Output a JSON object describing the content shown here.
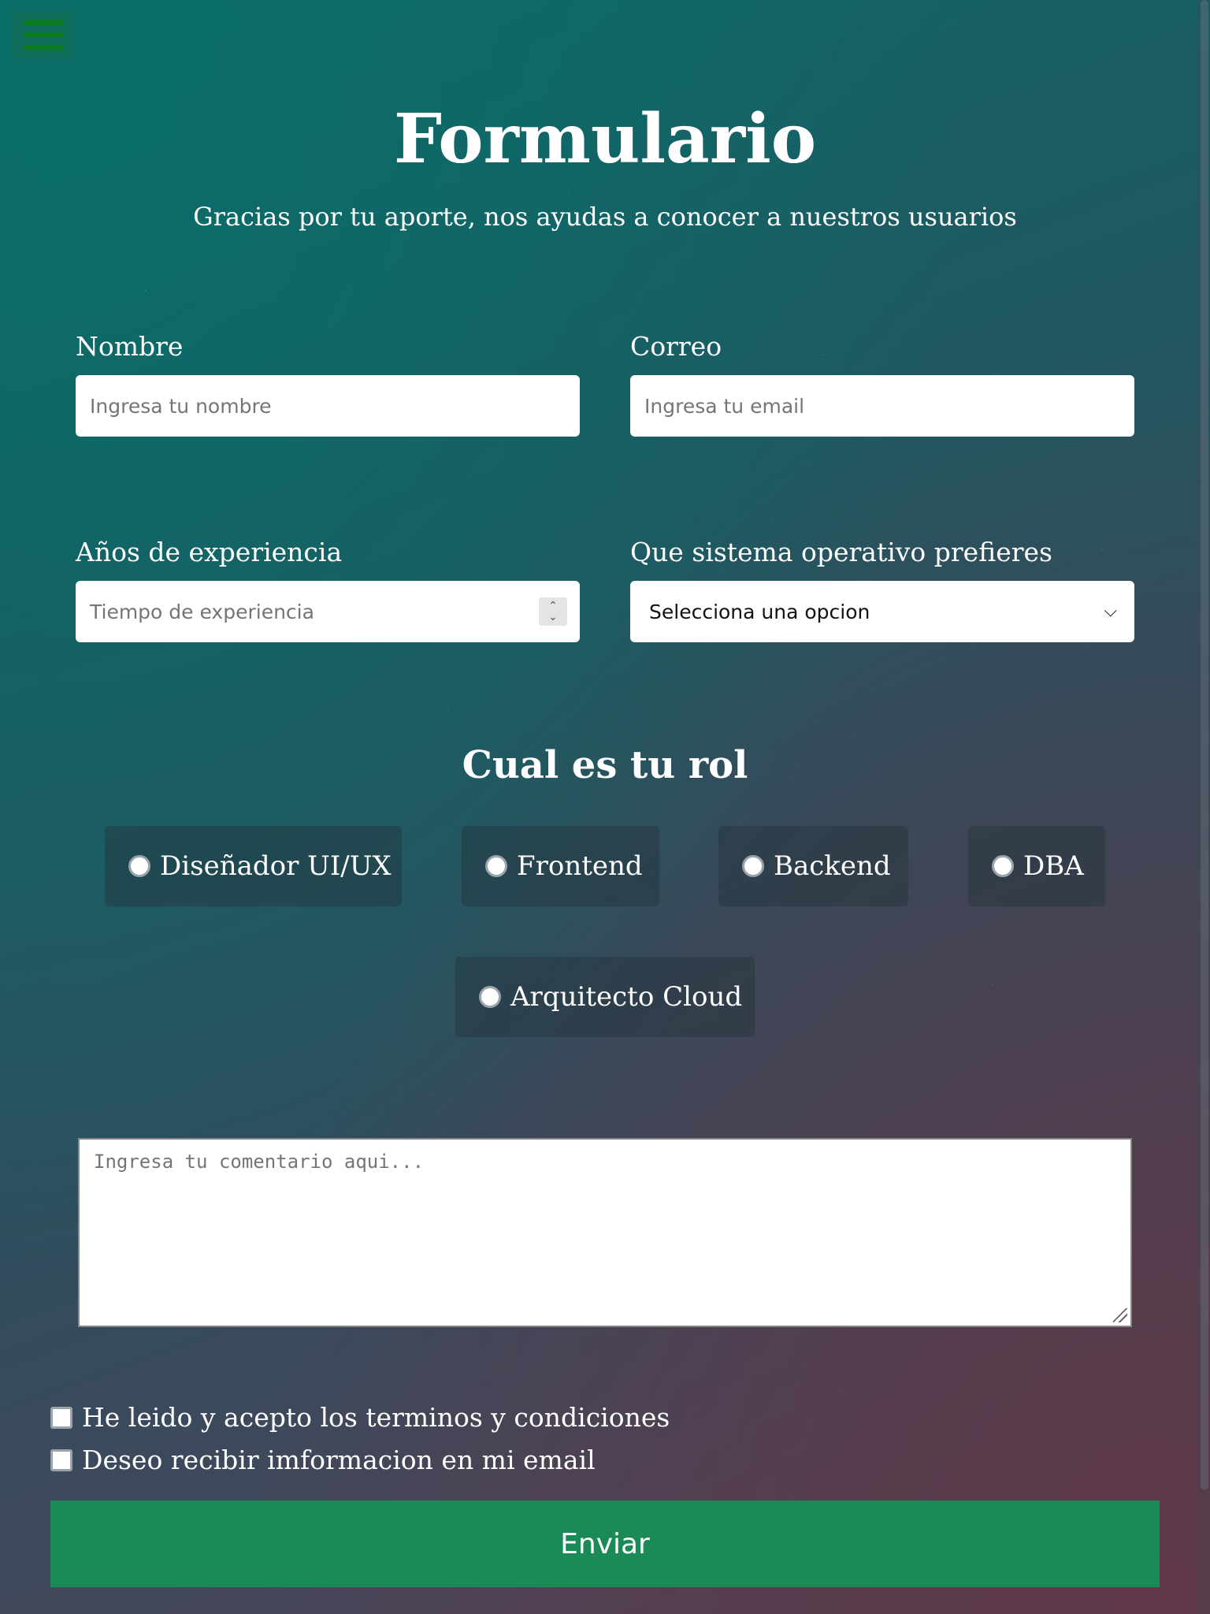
{
  "header": {
    "title": "Formulario",
    "subtitle": "Gracias por tu aporte, nos ayudas a conocer a nuestros usuarios",
    "menu_icon": "hamburger-menu-icon"
  },
  "form": {
    "name": {
      "label": "Nombre",
      "placeholder": "Ingresa tu nombre",
      "value": ""
    },
    "email": {
      "label": "Correo",
      "placeholder": "Ingresa tu email",
      "value": ""
    },
    "experience": {
      "label": "Años de experiencia",
      "placeholder": "Tiempo de experiencia",
      "value": ""
    },
    "os": {
      "label": "Que sistema operativo prefieres",
      "selected": "Selecciona una opcion"
    },
    "role": {
      "title": "Cual es tu rol",
      "options": [
        "Diseñador UI/UX",
        "Frontend",
        "Backend",
        "DBA",
        "Arquitecto Cloud"
      ]
    },
    "comment": {
      "placeholder": "Ingresa tu comentario aqui...",
      "value": ""
    },
    "checkboxes": [
      "He leido y acepto los terminos y condiciones",
      "Deseo recibir imformacion en mi email"
    ],
    "submit_label": "Enviar"
  },
  "colors": {
    "submit_button": "#1a8a56",
    "menu_icon": "#0a7a22",
    "background_start": "#0f6a68",
    "background_end": "#563f52"
  }
}
